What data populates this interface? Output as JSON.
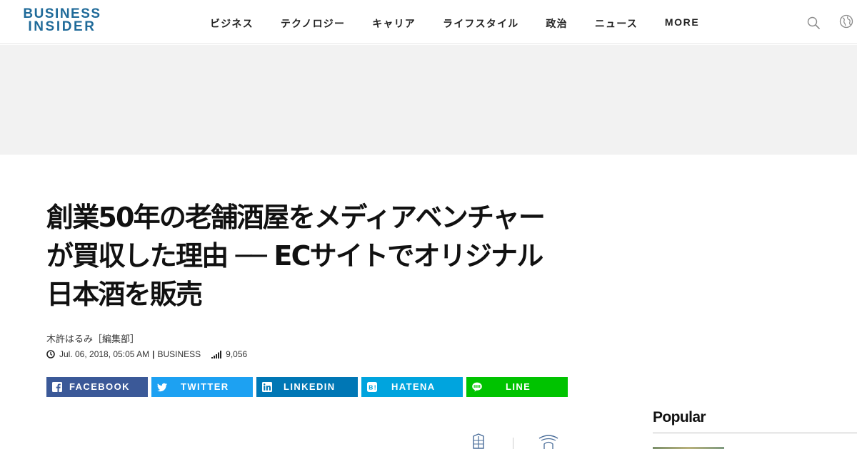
{
  "header": {
    "logo_line1": "BUSINESS",
    "logo_line2": "INSIDER",
    "nav": [
      "ビジネス",
      "テクノロジー",
      "キャリア",
      "ライフスタイル",
      "政治",
      "ニュース",
      "MORE"
    ],
    "icons": [
      "search-icon",
      "globe-icon"
    ]
  },
  "article": {
    "title": "創業50年の老舗酒屋をメディアベンチャーが買収した理由 ── ECサイトでオリジナル日本酒を販売",
    "author": "木許はるみ［編集部］",
    "datetime": "Jul. 06, 2018, 05:05 AM",
    "category": "BUSINESS",
    "views": "9,056"
  },
  "share_buttons": [
    {
      "label": "FACEBOOK",
      "color": "#3b5998",
      "icon": "facebook-icon"
    },
    {
      "label": "TWITTER",
      "color": "#1da1f2",
      "icon": "twitter-icon"
    },
    {
      "label": "LINKEDIN",
      "color": "#0077b5",
      "icon": "linkedin-icon"
    },
    {
      "label": "HATENA",
      "color": "#00a4de",
      "icon": "hatena-icon"
    },
    {
      "label": "LINE",
      "color": "#00c300",
      "icon": "line-icon"
    }
  ],
  "sidebar": {
    "popular_heading": "Popular"
  },
  "colors": {
    "brand": "#1f6a99",
    "ad_background": "#f2f2f2"
  }
}
